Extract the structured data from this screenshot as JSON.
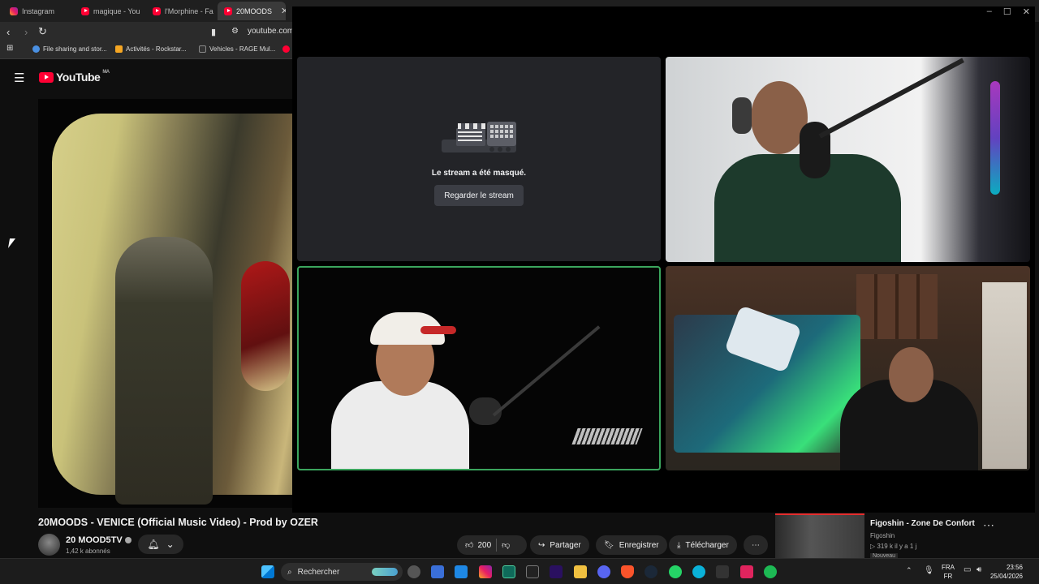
{
  "browser": {
    "tabs": [
      {
        "label": "Instagram",
        "icon": "instagram-icon"
      },
      {
        "label": "magique - You",
        "icon": "youtube-icon"
      },
      {
        "label": "l'Morphine - Fa",
        "icon": "youtube-icon"
      },
      {
        "label": "20MOODS",
        "icon": "youtube-icon",
        "active": true
      }
    ],
    "address": "youtube.com",
    "bookmarks": [
      "File sharing and stor...",
      "Activités - Rockstar...",
      "Vehicles - RAGE Mul..."
    ]
  },
  "youtube": {
    "logo": "YouTube",
    "region": "MA",
    "video_title": "20MOODS - VENICE (Official Music Video) - Prod by OZER",
    "channel_name": "20 MOOD5TV",
    "subscribers": "1,42 k abonnés",
    "likes": "200",
    "actions": {
      "share": "Partager",
      "save": "Enregistrer",
      "download": "Télécharger"
    },
    "recommended": {
      "title": "Figoshin - Zone De Confort",
      "channel": "Figoshin",
      "meta": "▷ 319 k  il y a 1 j",
      "badge": "Nouveau"
    }
  },
  "call": {
    "hidden_message": "Le stream a été masqué.",
    "watch_button": "Regarder le stream",
    "active_speaker_color": "#3ba55d"
  },
  "taskbar": {
    "search_placeholder": "Rechercher",
    "lang_top": "FRA",
    "lang_bottom": "FR",
    "time": "23:56",
    "date": "25/04/2026"
  },
  "colors": {
    "youtube_red": "#ff0033",
    "discord_bg": "#232428",
    "accent_green": "#3ba55d"
  }
}
